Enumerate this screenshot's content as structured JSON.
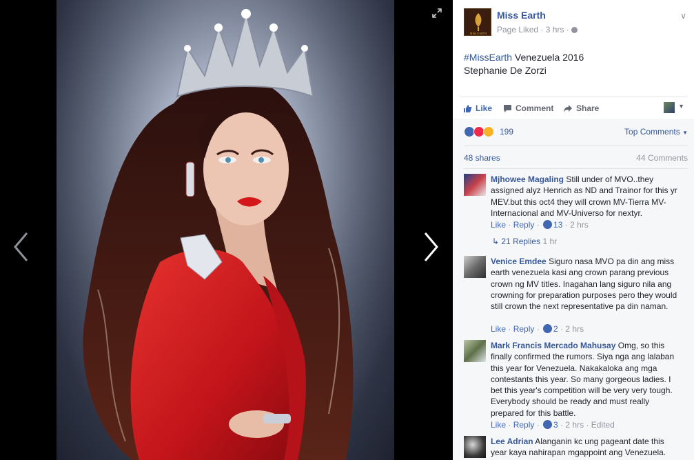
{
  "photo": {
    "colors": {
      "background": "#000000",
      "dress": "#d31f1f",
      "hair": "#3b1612",
      "lips": "#d4161a",
      "skin": "#e8c2ae"
    }
  },
  "page": {
    "name": "Miss Earth",
    "avatar_text": "MISS EARTH",
    "meta": "Page Liked · 3 hrs ·",
    "chevron": "∨"
  },
  "post": {
    "hashtag": "#MissEarth",
    "caption_rest": " Venezuela 2016",
    "caption_line2": "Stephanie De Zorzi"
  },
  "actions": {
    "like": "Like",
    "comment": "Comment",
    "share": "Share"
  },
  "reactions": {
    "count": "199",
    "top_comments": "Top Comments",
    "shares": "48 shares",
    "comments": "44 Comments"
  },
  "comments": [
    {
      "author": "Mjhowee Magaling",
      "text": "Still under of MVO..they assigned alyz Henrich as ND and Trainor for this yr MEV.but this oct4 they will crown MV-Tierra MV-Internacional and MV-Universo for nextyr.",
      "like": "Like",
      "reply": "Reply",
      "likes": "13",
      "time": "2 hrs",
      "replies": "21 Replies",
      "replies_time": "1 hr"
    },
    {
      "author": "Venice Emdee",
      "text": "Siguro nasa MVO pa din ang miss earth venezuela kasi ang crown parang previous crown ng MV titles. Inagahan lang siguro nila ang crowning for preparation purposes pero they would still crown the next representative pa din naman.",
      "like": "Like",
      "reply": "Reply",
      "likes": "2",
      "time": "2 hrs"
    },
    {
      "author": "Mark Francis Mercado Mahusay",
      "text": "Omg, so this finally confirmed the rumors. Siya nga ang lalaban this year for Venezuela. Nakakaloka ang mga contestants this year. So many gorgeous ladies. I bet this year's competition will be very very tough. Everybody should be ready and must really prepared for this battle.",
      "like": "Like",
      "reply": "Reply",
      "likes": "3",
      "time": "2 hrs · Edited"
    },
    {
      "author": "Lee Adrian",
      "text": "Alanganin kc ung pageant date this year kaya nahirapan mgappoint ang Venezuela."
    }
  ]
}
